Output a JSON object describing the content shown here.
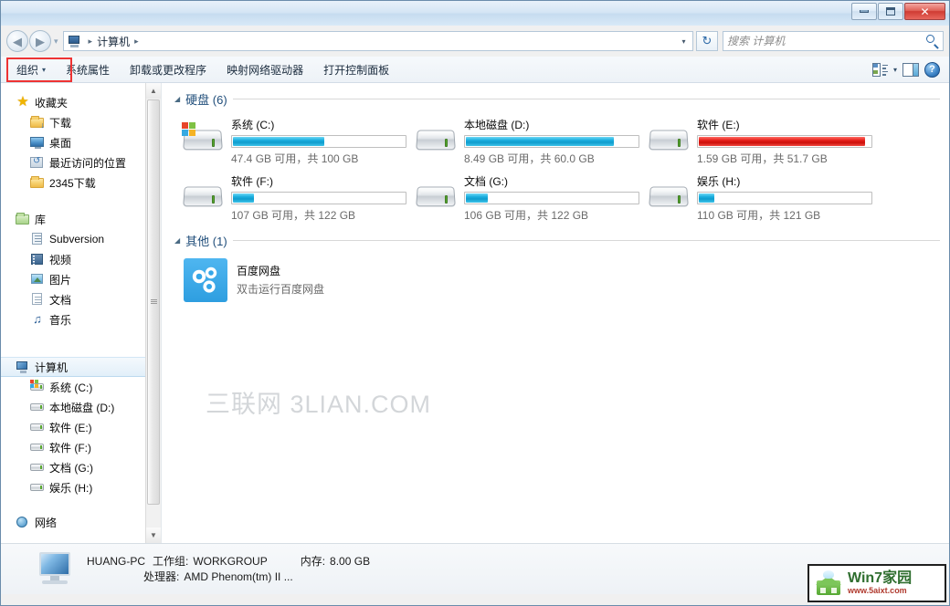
{
  "window": {
    "minimize_label": "─",
    "maximize_label": "□",
    "close_label": "✕"
  },
  "address_bar": {
    "back_icon": "back-arrow-icon",
    "forward_icon": "forward-arrow-icon",
    "history_caret": "▾",
    "breadcrumb_root": "计算机",
    "sep": "▸",
    "dropdown_caret": "▾",
    "refresh_icon": "↻"
  },
  "search": {
    "placeholder": "搜索 计算机",
    "value": ""
  },
  "toolbar": {
    "organize_label": "组织",
    "organize_caret": "▾",
    "items": [
      {
        "label": "系统属性"
      },
      {
        "label": "卸载或更改程序"
      },
      {
        "label": "映射网络驱动器"
      },
      {
        "label": "打开控制面板"
      }
    ],
    "views_caret": "▾",
    "help_label": "?",
    "highlight_color": "#ee3333"
  },
  "sidebar": {
    "groups": [
      {
        "head": {
          "label": "收藏夹",
          "icon": "star-icon"
        },
        "items": [
          {
            "label": "下载",
            "icon": "download-folder-icon"
          },
          {
            "label": "桌面",
            "icon": "desktop-icon"
          },
          {
            "label": "最近访问的位置",
            "icon": "recent-places-icon"
          },
          {
            "label": "2345下载",
            "icon": "folder-icon"
          }
        ]
      },
      {
        "head": {
          "label": "库",
          "icon": "library-folder-icon"
        },
        "items": [
          {
            "label": "Subversion",
            "icon": "subversion-icon"
          },
          {
            "label": "视频",
            "icon": "video-icon"
          },
          {
            "label": "图片",
            "icon": "picture-icon"
          },
          {
            "label": "文档",
            "icon": "document-icon"
          },
          {
            "label": "音乐",
            "icon": "music-icon"
          }
        ]
      },
      {
        "head": {
          "label": "计算机",
          "icon": "computer-icon",
          "selected": true
        },
        "items": [
          {
            "label": "系统 (C:)",
            "icon": "windows-drive-icon"
          },
          {
            "label": "本地磁盘 (D:)",
            "icon": "drive-icon"
          },
          {
            "label": "软件 (E:)",
            "icon": "drive-icon"
          },
          {
            "label": "软件 (F:)",
            "icon": "drive-icon"
          },
          {
            "label": "文档 (G:)",
            "icon": "drive-icon"
          },
          {
            "label": "娱乐 (H:)",
            "icon": "drive-icon"
          }
        ]
      },
      {
        "head": {
          "label": "网络",
          "icon": "network-icon"
        },
        "items": []
      }
    ],
    "scroll_up": "▲",
    "scroll_down": "▼"
  },
  "content": {
    "groups": [
      {
        "title": "硬盘 (6)",
        "collapse_caret": "◢",
        "drives": [
          {
            "name": "系统 (C:)",
            "info": "47.4 GB 可用，共 100 GB",
            "used_percent": 53,
            "bar_color": "blue",
            "icon": "windows-drive-icon"
          },
          {
            "name": "本地磁盘 (D:)",
            "info": "8.49 GB 可用，共 60.0 GB",
            "used_percent": 86,
            "bar_color": "blue",
            "icon": "drive-icon"
          },
          {
            "name": "软件 (E:)",
            "info": "1.59 GB 可用，共 51.7 GB",
            "used_percent": 97,
            "bar_color": "red",
            "icon": "drive-icon"
          },
          {
            "name": "软件 (F:)",
            "info": "107 GB 可用，共 122 GB",
            "used_percent": 12,
            "bar_color": "blue",
            "icon": "drive-icon"
          },
          {
            "name": "文档 (G:)",
            "info": "106 GB 可用，共 122 GB",
            "used_percent": 13,
            "bar_color": "blue",
            "icon": "drive-icon"
          },
          {
            "name": "娱乐 (H:)",
            "info": "110 GB 可用，共 121 GB",
            "used_percent": 9,
            "bar_color": "blue",
            "icon": "drive-icon"
          }
        ]
      },
      {
        "title": "其他 (1)",
        "collapse_caret": "◢",
        "items": [
          {
            "name": "百度网盘",
            "sub": "双击运行百度网盘",
            "icon": "baidu-netdisk-icon"
          }
        ]
      }
    ]
  },
  "status": {
    "computer_name": "HUANG-PC",
    "workgroup_key": "工作组:",
    "workgroup_value": "WORKGROUP",
    "memory_key": "内存:",
    "memory_value": "8.00 GB",
    "cpu_key": "处理器:",
    "cpu_value": "AMD Phenom(tm) II ..."
  },
  "watermarks": {
    "center": "三联网 3LIAN.COM",
    "badge_title": "Win7家园",
    "badge_url": "www.5aixt.com"
  }
}
